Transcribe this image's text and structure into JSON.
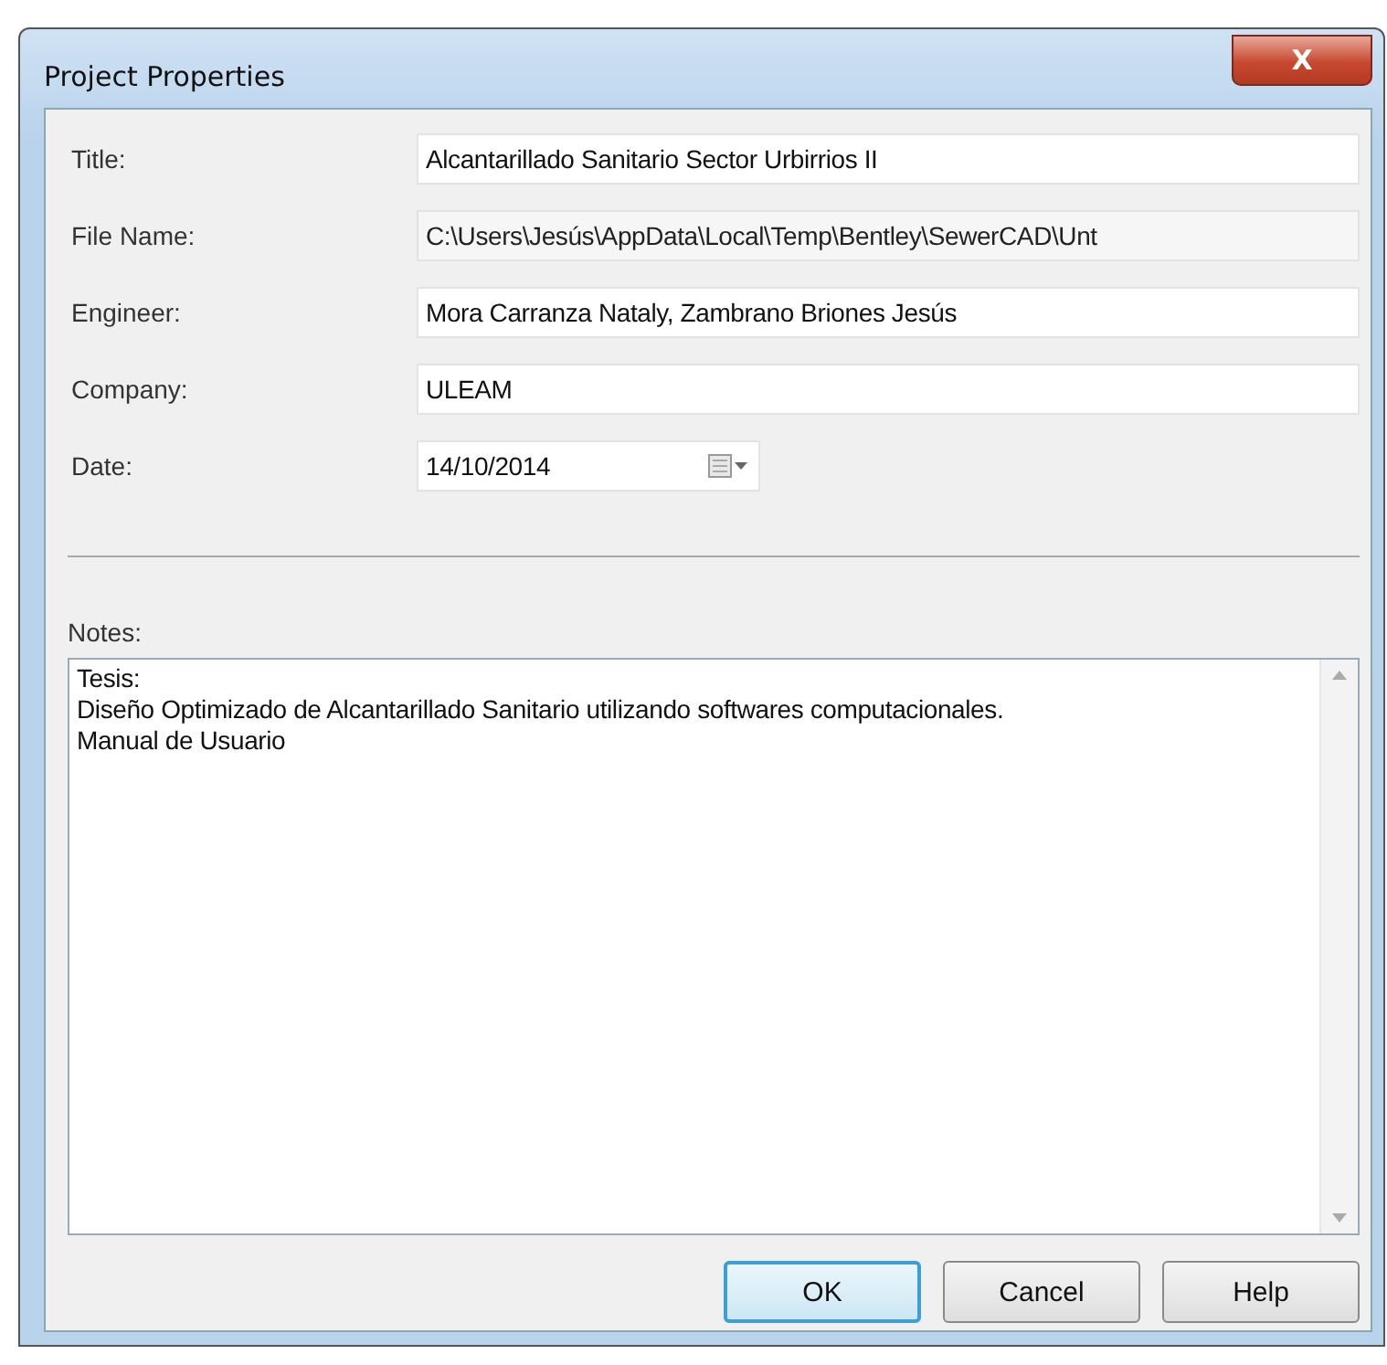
{
  "window": {
    "title": "Project Properties",
    "close_label": "X"
  },
  "fields": [
    {
      "label": "Title:",
      "value": "Alcantarillado Sanitario Sector Urbirrios II",
      "readonly": false,
      "kind": "text"
    },
    {
      "label": "File Name:",
      "value": "C:\\Users\\Jesús\\AppData\\Local\\Temp\\Bentley\\SewerCAD\\Unt",
      "readonly": true,
      "kind": "text"
    },
    {
      "label": "Engineer:",
      "value": "Mora Carranza Nataly, Zambrano Briones Jesús",
      "readonly": false,
      "kind": "text"
    },
    {
      "label": "Company:",
      "value": "ULEAM",
      "readonly": false,
      "kind": "text"
    },
    {
      "label": "Date:",
      "value": "14/10/2014",
      "readonly": false,
      "kind": "date"
    }
  ],
  "notes": {
    "label": "Notes:",
    "lines": [
      "Tesis:",
      "Diseño Optimizado de Alcantarillado Sanitario utilizando softwares computacionales.",
      "Manual de Usuario"
    ]
  },
  "buttons": [
    {
      "label": "OK",
      "default": true
    },
    {
      "label": "Cancel",
      "default": false
    },
    {
      "label": "Help",
      "default": false
    }
  ]
}
